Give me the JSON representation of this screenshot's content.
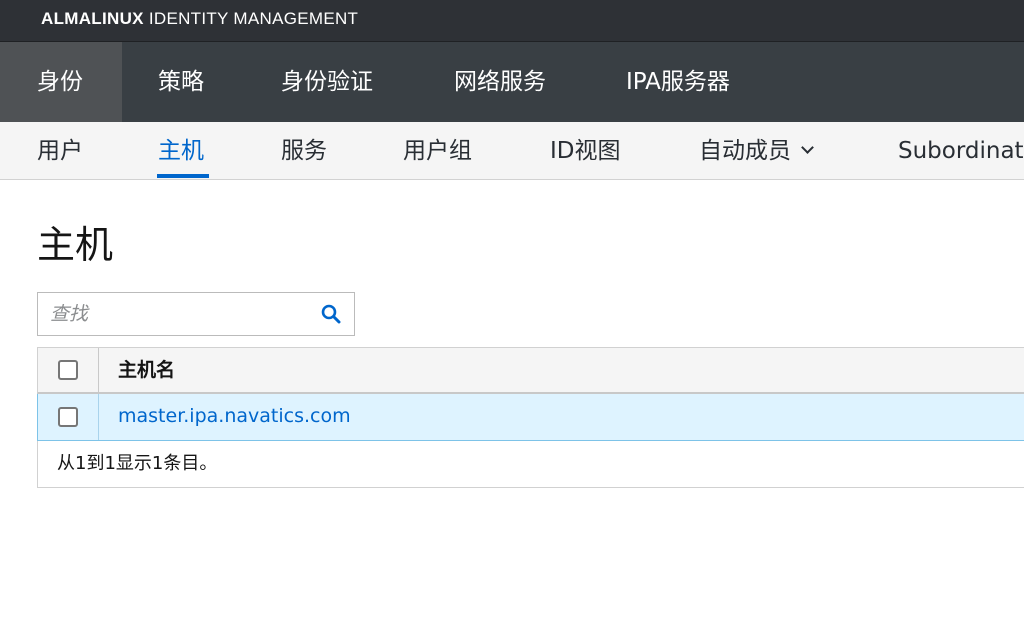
{
  "brand": {
    "bold": "ALMALINUX",
    "rest": "IDENTITY MANAGEMENT"
  },
  "main_nav": {
    "items": [
      {
        "label": "身份",
        "active": true
      },
      {
        "label": "策略",
        "active": false
      },
      {
        "label": "身份验证",
        "active": false
      },
      {
        "label": "网络服务",
        "active": false
      },
      {
        "label": "IPA服务器",
        "active": false
      }
    ]
  },
  "sub_nav": {
    "items": [
      {
        "label": "用户",
        "active": false
      },
      {
        "label": "主机",
        "active": true
      },
      {
        "label": "服务",
        "active": false
      },
      {
        "label": "用户组",
        "active": false
      },
      {
        "label": "ID视图",
        "active": false
      },
      {
        "label": "自动成员",
        "active": false,
        "icon": "chevron-down-icon"
      },
      {
        "label": "Subordinate IDs",
        "active": false
      }
    ]
  },
  "page": {
    "title": "主机"
  },
  "search": {
    "placeholder": "查找",
    "value": "",
    "icon": "search-icon"
  },
  "table": {
    "columns": [
      "主机名"
    ],
    "rows": [
      {
        "hostname": "master.ipa.navatics.com",
        "selected": false
      }
    ],
    "footer": "从1到1显示1条目。"
  },
  "colors": {
    "accent": "#0066cc",
    "brand_bar": "#2e3136",
    "nav_bar": "#393f44",
    "row_highlight": "#def3ff"
  }
}
